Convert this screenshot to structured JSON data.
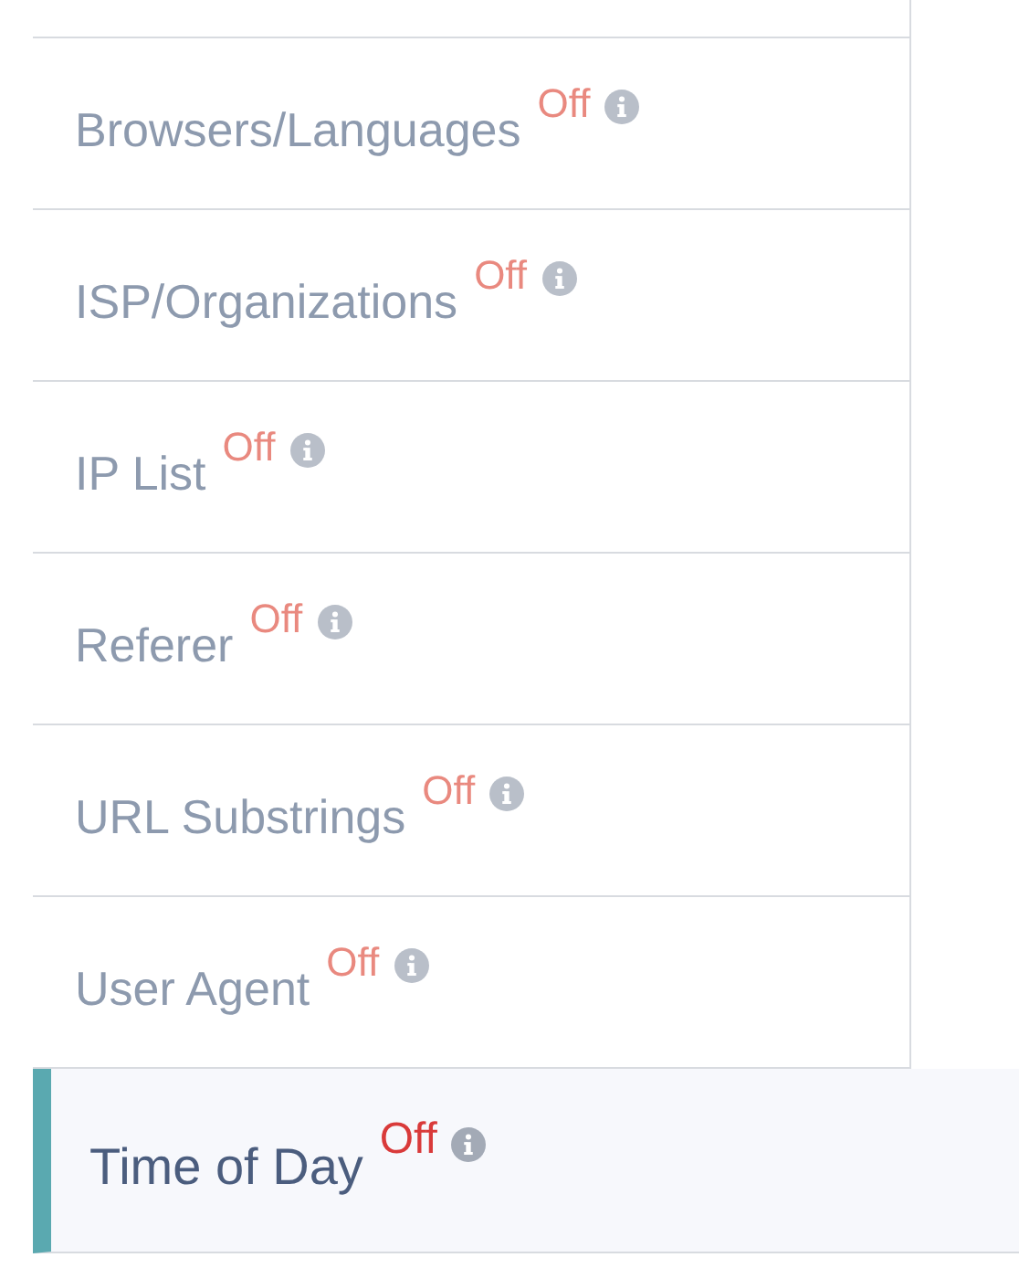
{
  "filters": [
    {
      "label": "Browsers/Languages",
      "status": "Off",
      "selected": false
    },
    {
      "label": "ISP/Organizations",
      "status": "Off",
      "selected": false
    },
    {
      "label": "IP List",
      "status": "Off",
      "selected": false
    },
    {
      "label": "Referer",
      "status": "Off",
      "selected": false
    },
    {
      "label": "URL Substrings",
      "status": "Off",
      "selected": false
    },
    {
      "label": "User Agent",
      "status": "Off",
      "selected": false
    },
    {
      "label": "Time of Day",
      "status": "Off",
      "selected": true
    }
  ]
}
